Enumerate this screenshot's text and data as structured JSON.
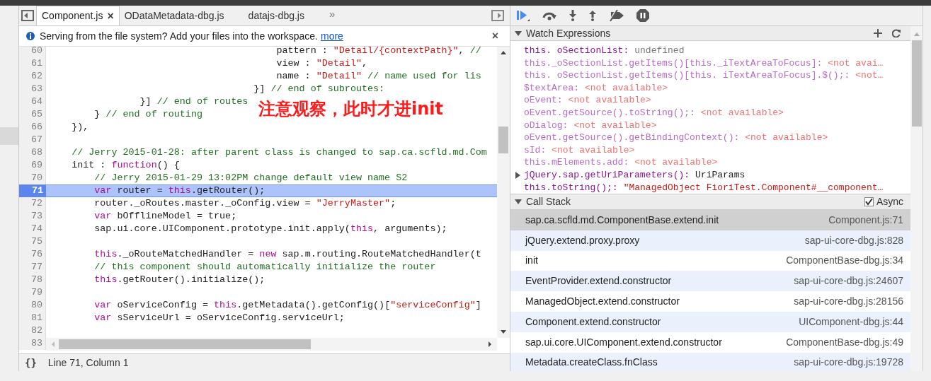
{
  "editor": {
    "tabs": [
      {
        "label": "Component.js",
        "selected": true,
        "close": "×"
      },
      {
        "label": "ODataMetadata-dbg.js",
        "selected": false
      },
      {
        "label": "datajs-dbg.js",
        "selected": false
      }
    ],
    "tabs_overflow": "»",
    "infobar": {
      "message": "Serving from the file system? Add your files into the workspace.",
      "link": "more",
      "close": "×"
    },
    "lines": [
      {
        "number": "60",
        "paused": false,
        "segments": [
          {
            "kind": "plain",
            "text": "                                        pattern : "
          },
          {
            "kind": "string",
            "text": "\"Detail/{contextPath}\""
          },
          {
            "kind": "plain",
            "text": ","
          },
          {
            "kind": "comment",
            "text": " //"
          }
        ]
      },
      {
        "number": "61",
        "paused": false,
        "segments": [
          {
            "kind": "plain",
            "text": "                                        view : "
          },
          {
            "kind": "string",
            "text": "\"Detail\""
          },
          {
            "kind": "plain",
            "text": ","
          }
        ]
      },
      {
        "number": "62",
        "paused": false,
        "segments": [
          {
            "kind": "plain",
            "text": "                                        name : "
          },
          {
            "kind": "string",
            "text": "\"Detail\""
          },
          {
            "kind": "comment",
            "text": " // name used for lis"
          }
        ]
      },
      {
        "number": "63",
        "paused": false,
        "segments": [
          {
            "kind": "plain",
            "text": "                                    }]"
          },
          {
            "kind": "comment",
            "text": " // end of subroutes:"
          }
        ]
      },
      {
        "number": "64",
        "paused": false,
        "segments": [
          {
            "kind": "plain",
            "text": "                }]"
          },
          {
            "kind": "comment",
            "text": " // end of routes"
          }
        ]
      },
      {
        "number": "65",
        "paused": false,
        "segments": [
          {
            "kind": "plain",
            "text": "        }"
          },
          {
            "kind": "comment",
            "text": " // end of routing"
          }
        ]
      },
      {
        "number": "66",
        "paused": false,
        "segments": [
          {
            "kind": "plain",
            "text": "    }),"
          }
        ]
      },
      {
        "number": "67",
        "paused": false
      },
      {
        "number": "68",
        "paused": false,
        "segments": [
          {
            "kind": "comment",
            "text": "    // Jerry 2015-01-28: after parent class is changed to sap.ca.scfld.md.Com"
          }
        ]
      },
      {
        "number": "69",
        "paused": false,
        "segments": [
          {
            "kind": "plain",
            "text": "    init : "
          },
          {
            "kind": "keyword",
            "text": "function"
          },
          {
            "kind": "plain",
            "text": "() {"
          }
        ]
      },
      {
        "number": "70",
        "paused": false,
        "segments": [
          {
            "kind": "comment",
            "text": "        // Jerry 2015-01-29 13:02PM change default view name S2"
          }
        ]
      },
      {
        "number": "71",
        "paused": true,
        "segments": [
          {
            "kind": "keyword",
            "text": "        var"
          },
          {
            "kind": "plain",
            "text": " router = "
          },
          {
            "kind": "keyword",
            "text": "this"
          },
          {
            "kind": "plain",
            "text": ".getRouter();"
          }
        ]
      },
      {
        "number": "72",
        "paused": false,
        "segments": [
          {
            "kind": "plain",
            "text": "        router._oRoutes.master._oConfig.view = "
          },
          {
            "kind": "string",
            "text": "\"JerryMaster\""
          },
          {
            "kind": "plain",
            "text": ";"
          }
        ]
      },
      {
        "number": "73",
        "paused": false,
        "segments": [
          {
            "kind": "keyword",
            "text": "        var"
          },
          {
            "kind": "plain",
            "text": " bOfflineModel = true;"
          }
        ]
      },
      {
        "number": "74",
        "paused": false,
        "segments": [
          {
            "kind": "plain",
            "text": "        sap.ui.core.UIComponent.prototype.init.apply("
          },
          {
            "kind": "keyword",
            "text": "this"
          },
          {
            "kind": "plain",
            "text": ", arguments);"
          }
        ]
      },
      {
        "number": "75",
        "paused": false
      },
      {
        "number": "76",
        "paused": false,
        "segments": [
          {
            "kind": "keyword",
            "text": "        this"
          },
          {
            "kind": "plain",
            "text": "._oRouteMatchedHandler = "
          },
          {
            "kind": "keyword",
            "text": "new"
          },
          {
            "kind": "plain",
            "text": " sap.m.routing.RouteMatchedHandler(t"
          }
        ]
      },
      {
        "number": "77",
        "paused": false,
        "segments": [
          {
            "kind": "comment",
            "text": "        // this component should automatically initialize the router"
          }
        ]
      },
      {
        "number": "78",
        "paused": false,
        "segments": [
          {
            "kind": "keyword",
            "text": "        this"
          },
          {
            "kind": "plain",
            "text": ".getRouter().initialize();"
          }
        ]
      },
      {
        "number": "79",
        "paused": false
      },
      {
        "number": "80",
        "paused": false,
        "segments": [
          {
            "kind": "keyword",
            "text": "        var"
          },
          {
            "kind": "plain",
            "text": " oServiceConfig = "
          },
          {
            "kind": "keyword",
            "text": "this"
          },
          {
            "kind": "plain",
            "text": ".getMetadata().getConfig()["
          },
          {
            "kind": "string",
            "text": "\"serviceConfig\""
          },
          {
            "kind": "plain",
            "text": "]"
          }
        ]
      },
      {
        "number": "81",
        "paused": false,
        "segments": [
          {
            "kind": "keyword",
            "text": "        var"
          },
          {
            "kind": "plain",
            "text": " sServiceUrl = oServiceConfig.serviceUrl;"
          }
        ]
      },
      {
        "number": "82",
        "paused": false
      },
      {
        "number": "83",
        "paused": false
      }
    ],
    "annotation": "注意观察，此时才进init",
    "status": {
      "format_button": "{}",
      "position": "Line 71, Column 1"
    }
  },
  "debugger": {
    "watch": {
      "title": "Watch Expressions",
      "items": [
        {
          "expression": "this. oSectionList:",
          "value": "undefined",
          "kind": "undefined"
        },
        {
          "expression": "this._oSectionList.getItems()[this._iTextAreaToFocus]:",
          "value": "<not avai…",
          "kind": "unavailable"
        },
        {
          "expression": "this. oSectionList.getItems()[this. iTextAreaToFocus].$();:",
          "value": "<not…",
          "kind": "unavailable"
        },
        {
          "expression": "$textArea:",
          "value": "<not available>",
          "kind": "unavailable"
        },
        {
          "expression": "oEvent:",
          "value": "<not available>",
          "kind": "unavailable"
        },
        {
          "expression": "oEvent.getSource().toString();:",
          "value": "<not available>",
          "kind": "unavailable"
        },
        {
          "expression": "oDialog:",
          "value": "<not available>",
          "kind": "unavailable"
        },
        {
          "expression": "oEvent.getSource().getBindingContext():",
          "value": "<not available>",
          "kind": "unavailable"
        },
        {
          "expression": "sId:",
          "value": "<not available>",
          "kind": "unavailable"
        },
        {
          "expression": "this.mElements.add:",
          "value": "<not available>",
          "kind": "unavailable"
        },
        {
          "expression": "jQuery.sap.getUriParameters():",
          "value": "UriParams",
          "kind": "object"
        },
        {
          "expression": "this.toString();:",
          "value": "\"ManagedObject FioriTest.Component#__component…",
          "kind": "string"
        }
      ]
    },
    "call_stack": {
      "title": "Call Stack",
      "async": {
        "label": "Async",
        "checked": true
      },
      "frames": [
        {
          "function": "sap.ca.scfld.md.ComponentBase.extend.init",
          "location": "Component.js:71",
          "selected": true
        },
        {
          "function": "jQuery.extend.proxy.proxy",
          "location": "sap-ui-core-dbg.js:828",
          "selected": false
        },
        {
          "function": "init",
          "location": "ComponentBase-dbg.js:34",
          "selected": false
        },
        {
          "function": "EventProvider.extend.constructor",
          "location": "sap-ui-core-dbg.js:24607",
          "selected": false
        },
        {
          "function": "ManagedObject.extend.constructor",
          "location": "sap-ui-core-dbg.js:28156",
          "selected": false
        },
        {
          "function": "Component.extend.constructor",
          "location": "UIComponent-dbg.js:44",
          "selected": false
        },
        {
          "function": "sap.ui.core.UIComponent.extend.constructor",
          "location": "ComponentBase-dbg.js:49",
          "selected": false
        },
        {
          "function": "Metadata.createClass.fnClass",
          "location": "sap-ui-core-dbg.js:19728",
          "selected": false
        }
      ]
    }
  }
}
